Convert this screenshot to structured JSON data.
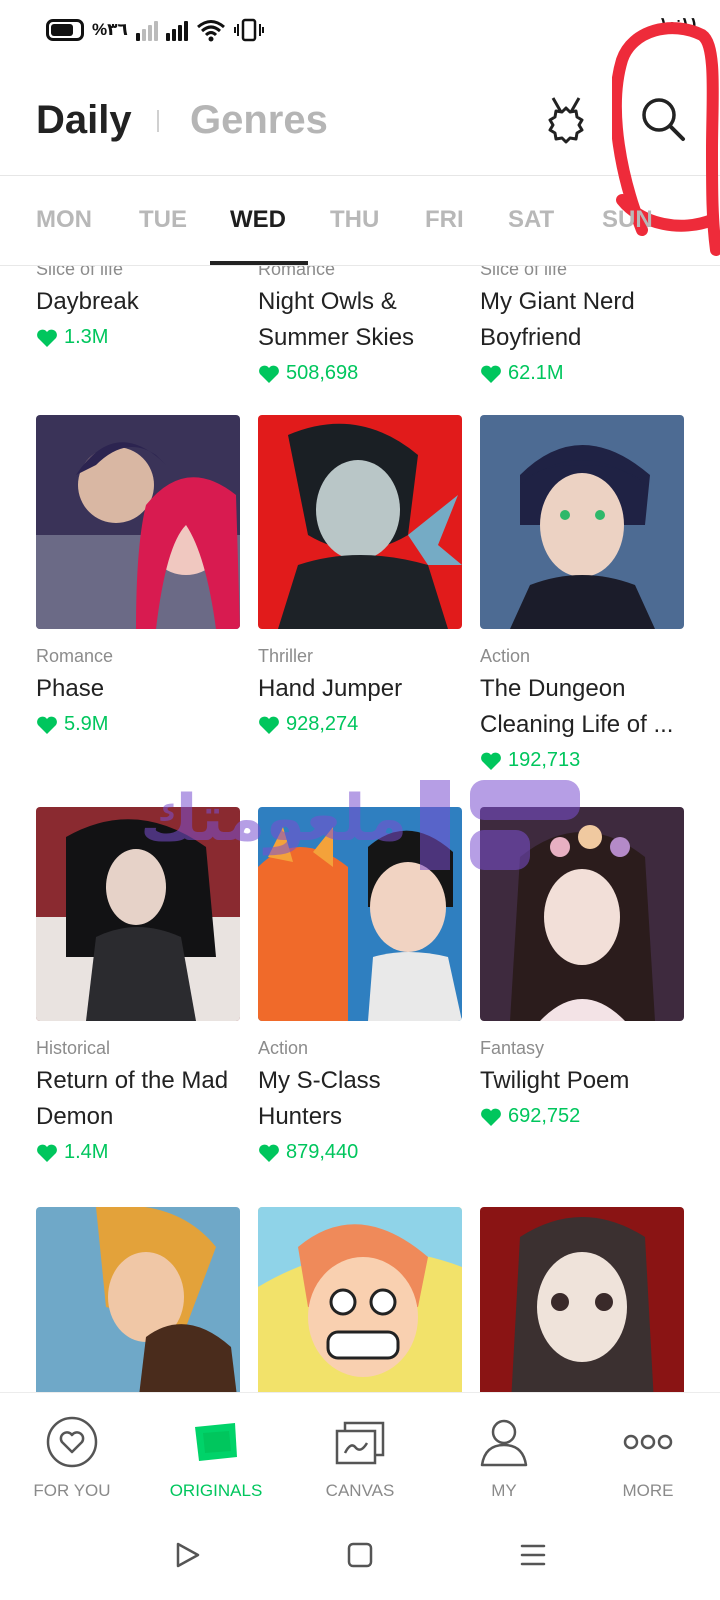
{
  "status_bar": {
    "battery_text": "%٣٦",
    "time": "١٠:١١"
  },
  "header": {
    "tab_daily": "Daily",
    "tab_genres": "Genres",
    "icons": [
      "award-icon",
      "search-icon"
    ]
  },
  "days": [
    "MON",
    "TUE",
    "WED",
    "THU",
    "FRI",
    "SAT",
    "SUN"
  ],
  "active_day": "WED",
  "comics": [
    {
      "genre": "Slice of life",
      "title": "Daybreak",
      "likes": "1.3M"
    },
    {
      "genre": "Romance",
      "title": "Night Owls & Summer Skies",
      "likes": "508,698"
    },
    {
      "genre": "Slice of life",
      "title": "My Giant Nerd Boyfriend",
      "likes": "62.1M"
    },
    {
      "genre": "Romance",
      "title": "Phase",
      "likes": "5.9M"
    },
    {
      "genre": "Thriller",
      "title": "Hand Jumper",
      "likes": "928,274"
    },
    {
      "genre": "Action",
      "title": "The Dungeon Cleaning Life of ...",
      "likes": "192,713"
    },
    {
      "genre": "Historical",
      "title": "Return of the Mad Demon",
      "likes": "1.4M"
    },
    {
      "genre": "Action",
      "title": "My S-Class Hunters",
      "likes": "879,440"
    },
    {
      "genre": "Fantasy",
      "title": "Twilight Poem",
      "likes": "692,752"
    }
  ],
  "watermark": "ملعومتك",
  "bottom_nav": [
    {
      "label": "FOR YOU",
      "icon": "heart-circle-icon"
    },
    {
      "label": "ORIGINALS",
      "icon": "originals-icon"
    },
    {
      "label": "CANVAS",
      "icon": "canvas-icon"
    },
    {
      "label": "MY",
      "icon": "person-icon"
    },
    {
      "label": "MORE",
      "icon": "more-dots-icon"
    }
  ],
  "colors": {
    "accent": "#00c65d",
    "annotation": "#ee2b3a"
  }
}
